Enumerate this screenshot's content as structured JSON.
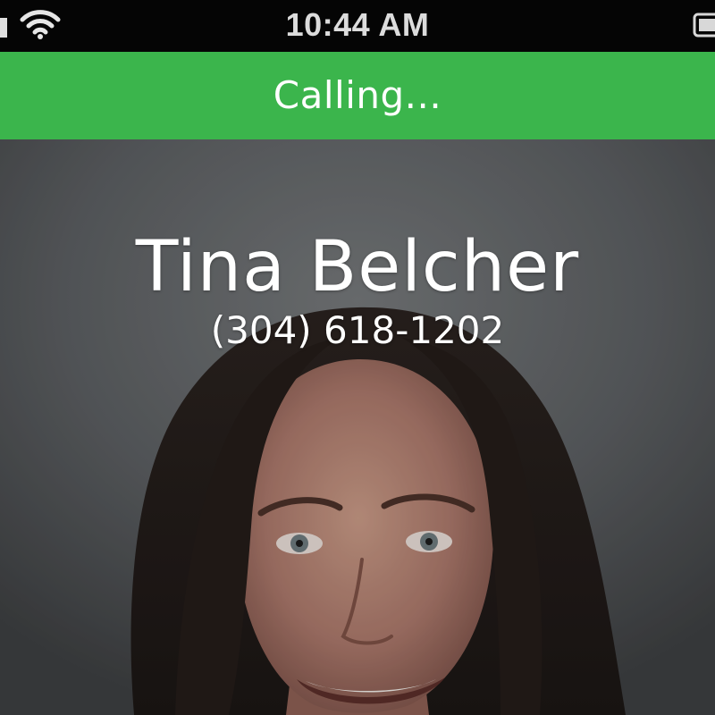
{
  "status_bar": {
    "time": "10:44 AM",
    "signal_icon": "signal-bars-icon",
    "wifi_icon": "wifi-icon",
    "battery_icon": "battery-icon"
  },
  "call": {
    "status": "Calling...",
    "banner_color": "#3bb54c"
  },
  "contact": {
    "name": "Tina Belcher",
    "phone": "(304) 618-1202",
    "photo": "contact-photo"
  }
}
